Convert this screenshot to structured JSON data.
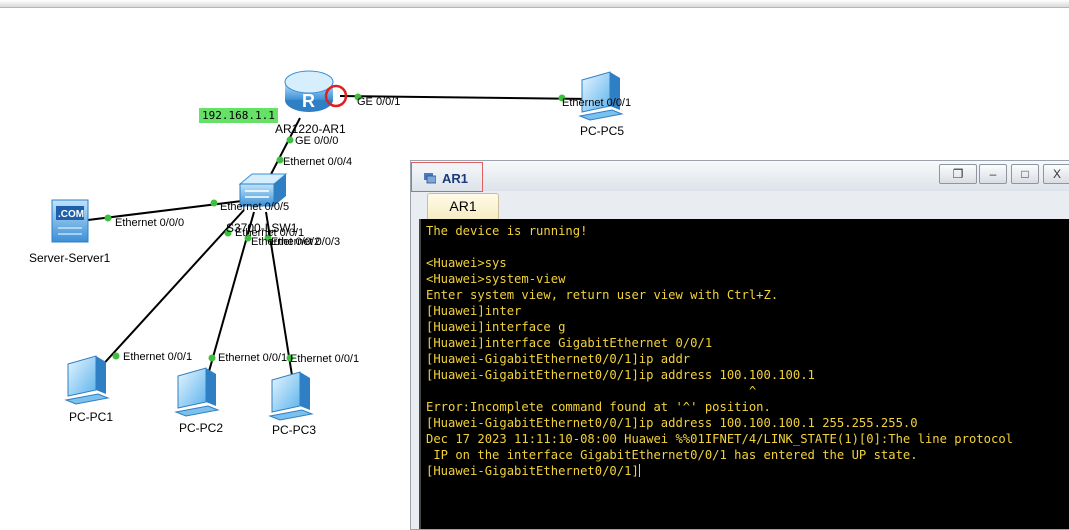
{
  "topology": {
    "devices": {
      "router": {
        "name": "AR1220-AR1",
        "ip_tag": "192.168.1.1"
      },
      "switch": {
        "name": "S3700-LSW1"
      },
      "server": {
        "name": "Server-Server1",
        "badge": ".COM"
      },
      "pc1": {
        "name": "PC-PC1"
      },
      "pc2": {
        "name": "PC-PC2"
      },
      "pc3": {
        "name": "PC-PC3"
      },
      "pc5": {
        "name": "PC-PC5"
      }
    },
    "ports": {
      "router_ge001": "GE 0/0/1",
      "pc5_e001": "Ethernet 0/0/1",
      "router_ge000": "GE 0/0/0",
      "switch_e004": "Ethernet 0/0/4",
      "switch_e005": "Ethernet 0/0/5",
      "server_e000": "Ethernet 0/0/0",
      "switch_e001": "Ethernet 0/0/1",
      "switch_e002": "Ethernet 0/0/2",
      "switch_e003": "Ethernet 0/0/3",
      "pc1_e001": "Ethernet 0/0/1",
      "pc2_e001": "Ethernet 0/0/1",
      "pc3_e001": "Ethernet 0/0/1"
    }
  },
  "window": {
    "title": "AR1",
    "tab_label": "AR1",
    "buttons": {
      "restore": "restore-icon",
      "minimize": "minimize-icon",
      "maximize": "maximize-icon",
      "close": "close-icon"
    }
  },
  "terminal": {
    "lines": [
      "The device is running!",
      "",
      "<Huawei>sys",
      "<Huawei>system-view",
      "Enter system view, return user view with Ctrl+Z.",
      "[Huawei]inter",
      "[Huawei]interface g",
      "[Huawei]interface GigabitEthernet 0/0/1",
      "[Huawei-GigabitEthernet0/0/1]ip addr",
      "[Huawei-GigabitEthernet0/0/1]ip address 100.100.100.1",
      "                                            ^",
      "Error:Incomplete command found at '^' position.",
      "[Huawei-GigabitEthernet0/0/1]ip address 100.100.100.1 255.255.255.0",
      "Dec 17 2023 11:11:10-08:00 Huawei %%01IFNET/4/LINK_STATE(1)[0]:The line protocol",
      " IP on the interface GigabitEthernet0/0/1 has entered the UP state.",
      "[Huawei-GigabitEthernet0/0/1]"
    ]
  },
  "colors": {
    "terminal_text": "#f2d23a",
    "terminal_bg": "#000000",
    "link": "#000000",
    "port_dot": "#3fbf3f",
    "ip_tag_bg": "#66e066",
    "router_marker": "#e02020"
  }
}
